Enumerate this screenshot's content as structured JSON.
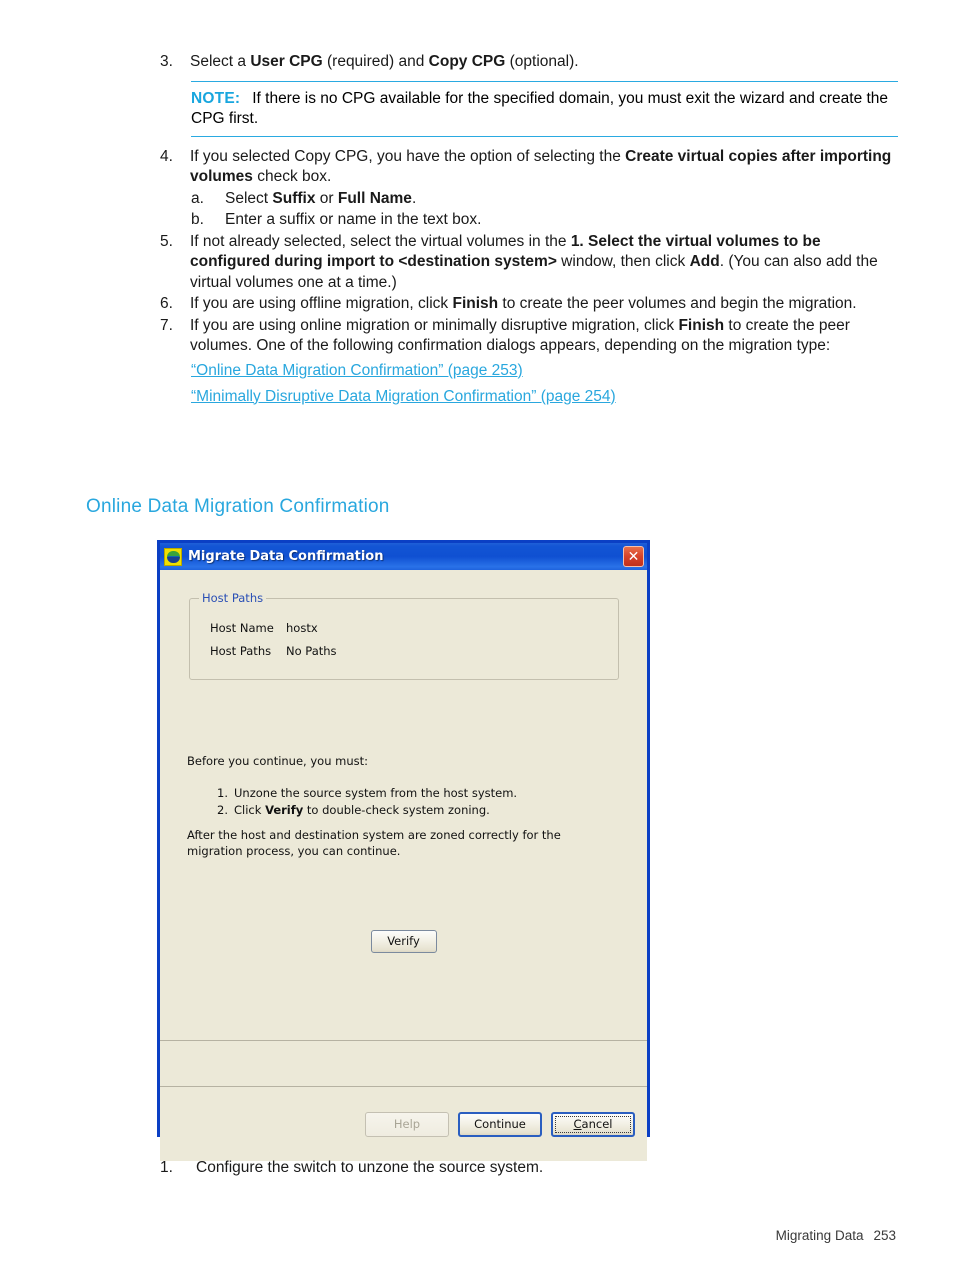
{
  "document": {
    "steps": [
      {
        "num": "3.",
        "segments": [
          {
            "t": "Select a ",
            "b": false
          },
          {
            "t": "User CPG",
            "b": true
          },
          {
            "t": " (required) and ",
            "b": false
          },
          {
            "t": "Copy CPG",
            "b": true
          },
          {
            "t": " (optional).",
            "b": false
          }
        ]
      },
      {
        "num": "4.",
        "segments": [
          {
            "t": "If you selected Copy CPG, you have the option of selecting the ",
            "b": false
          },
          {
            "t": "Create virtual copies after importing volumes",
            "b": true
          },
          {
            "t": " check box.",
            "b": false
          }
        ]
      },
      {
        "num": "a.",
        "sub": true,
        "segments": [
          {
            "t": "Select ",
            "b": false
          },
          {
            "t": "Suffix",
            "b": true
          },
          {
            "t": " or ",
            "b": false
          },
          {
            "t": "Full Name",
            "b": true
          },
          {
            "t": ".",
            "b": false
          }
        ]
      },
      {
        "num": "b.",
        "sub": true,
        "segments": [
          {
            "t": "Enter a suffix or name in the text box.",
            "b": false
          }
        ]
      },
      {
        "num": "5.",
        "segments": [
          {
            "t": "If not already selected, select the virtual volumes in the ",
            "b": false
          },
          {
            "t": "1. Select the virtual volumes to be configured during import to <destination system>",
            "b": true
          },
          {
            "t": " window, then click ",
            "b": false
          },
          {
            "t": "Add",
            "b": true
          },
          {
            "t": ". (You can also add the virtual volumes one at a time.)",
            "b": false
          }
        ]
      },
      {
        "num": "6.",
        "segments": [
          {
            "t": "If you are using offline migration, click ",
            "b": false
          },
          {
            "t": "Finish",
            "b": true
          },
          {
            "t": " to create the peer volumes and begin the migration.",
            "b": false
          }
        ]
      },
      {
        "num": "7.",
        "segments": [
          {
            "t": "If you are using online migration or minimally disruptive migration, click ",
            "b": false
          },
          {
            "t": "Finish",
            "b": true
          },
          {
            "t": " to create the peer volumes. One of the following confirmation dialogs appears, depending on the migration type:",
            "b": false
          }
        ]
      }
    ],
    "note": {
      "label": "NOTE:",
      "text": "If there is no CPG available for the specified domain, you must exit the wizard and create the CPG first."
    },
    "links": [
      "“Online Data Migration Confirmation” (page 253)",
      "“Minimally Disruptive Data Migration Confirmation” (page 254)"
    ],
    "section_heading": "Online Data Migration Confirmation",
    "post_step": {
      "num": "1.",
      "text": "Configure the switch to unzone the source system."
    },
    "footer": {
      "chapter": "Migrating Data",
      "page_number": "253"
    }
  },
  "dialog": {
    "title": "Migrate Data Confirmation",
    "close_label": "✕",
    "groupbox": {
      "title": "Host Paths",
      "rows": [
        {
          "label": "Host Name",
          "value": "hostx"
        },
        {
          "label": "Host Paths",
          "value": "No Paths"
        }
      ]
    },
    "intro": "Before you continue, you must:",
    "list": [
      {
        "n": "1.",
        "pre": "Unzone the source system from the host system.",
        "bold": "",
        "post": ""
      },
      {
        "n": "2.",
        "pre": "Click ",
        "bold": "Verify",
        "post": " to double-check system zoning."
      }
    ],
    "outro_line1": "After the host and destination system are zoned correctly for the",
    "outro_line2": "migration process, you can continue.",
    "verify_button": "Verify",
    "buttons": {
      "help": "Help",
      "continue": "Continue",
      "cancel_accel": "C",
      "cancel_rest": "ancel"
    }
  },
  "colors": {
    "link": "#29a7de",
    "heading": "#29a7de",
    "note_rule": "#2aaae1",
    "dialog_border": "#0b3fc4",
    "dialog_face": "#ece9d8",
    "titlebar": "#0f50d2",
    "groupbox_title": "#2a4fb5"
  }
}
